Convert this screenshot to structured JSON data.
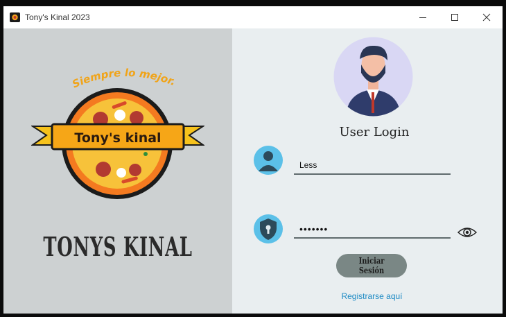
{
  "window": {
    "title": "Tony's Kinal 2023"
  },
  "brand": {
    "slogan": "Siempre lo mejor.!",
    "banner": "Tony's kinal",
    "name": "TONYS KINAL"
  },
  "login": {
    "title": "User Login",
    "username_value": "Less",
    "password_value": "•••••••",
    "submit_label": "Iniciar Sesión",
    "register_label": "Registrarse aquí"
  }
}
